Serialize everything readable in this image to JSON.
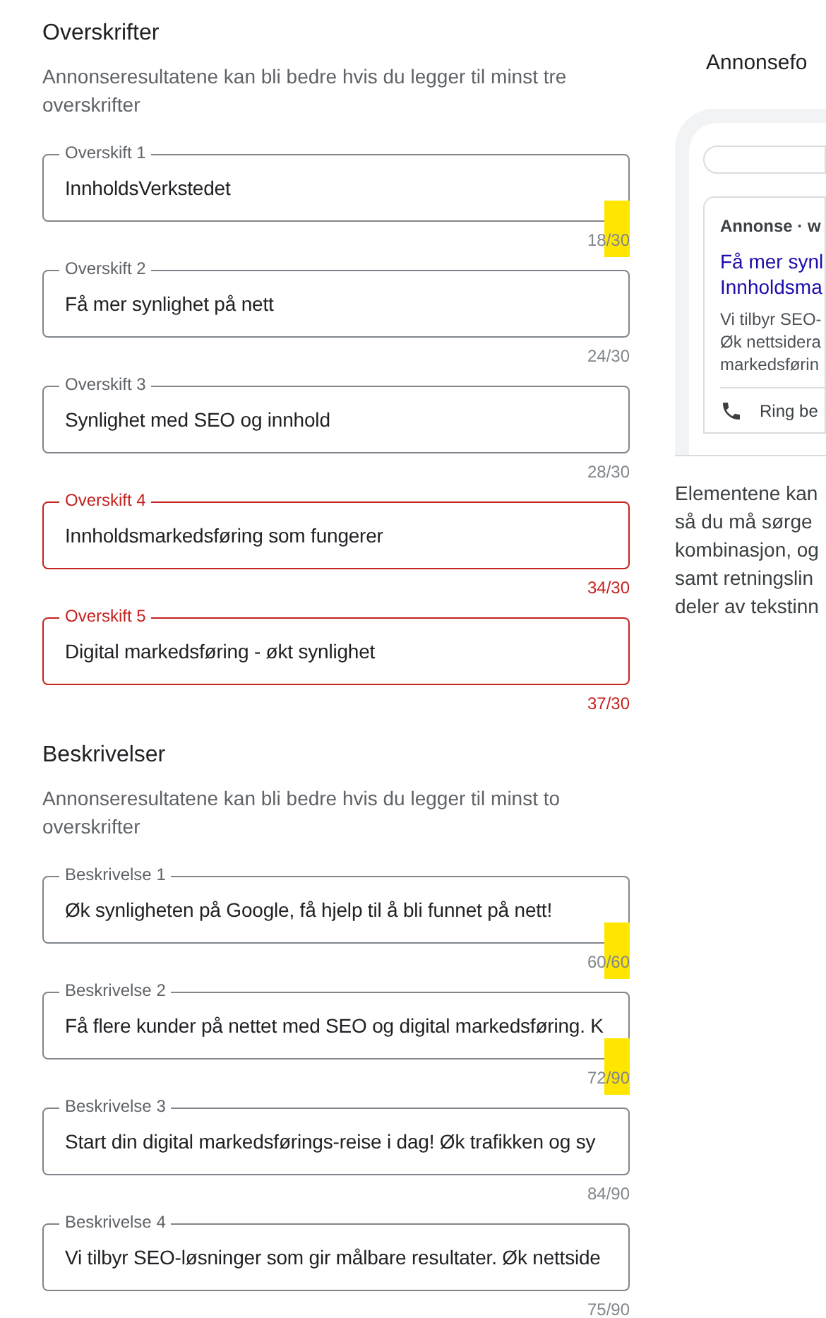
{
  "headlines": {
    "title": "Overskrifter",
    "hint": "Annonseresultatene kan bli bedre hvis du legger til minst tre overskrifter",
    "fields": [
      {
        "label": "Overskift 1",
        "value": "InnholdsVerkstedet",
        "counter": "18/30",
        "error": false,
        "highlighted": true
      },
      {
        "label": "Overskift 2",
        "value": "Få mer synlighet på nett",
        "counter": "24/30",
        "error": false,
        "highlighted": false
      },
      {
        "label": "Overskift 3",
        "value": "Synlighet med SEO og innhold",
        "counter": "28/30",
        "error": false,
        "highlighted": false
      },
      {
        "label": "Overskift 4",
        "value": "Innholdsmarkedsføring som fungerer",
        "counter": "34/30",
        "error": true,
        "highlighted": false
      },
      {
        "label": "Overskift 5",
        "value": "Digital markedsføring - økt synlighet",
        "counter": "37/30",
        "error": true,
        "highlighted": false
      }
    ]
  },
  "descriptions": {
    "title": "Beskrivelser",
    "hint": "Annonseresultatene kan bli bedre hvis du legger til minst to overskrifter",
    "fields": [
      {
        "label": "Beskrivelse 1",
        "value": "Øk synligheten på Google, få hjelp til å bli funnet på nett!",
        "counter": "60/60",
        "error": false,
        "highlighted": true
      },
      {
        "label": "Beskrivelse 2",
        "value": "Få flere kunder på nettet med SEO og digital markedsføring. K",
        "counter": "72/90",
        "error": false,
        "highlighted": true
      },
      {
        "label": "Beskrivelse 3",
        "value": "Start din digital markedsførings-reise i dag! Øk trafikken og sy",
        "counter": "84/90",
        "error": false,
        "highlighted": false
      },
      {
        "label": "Beskrivelse 4",
        "value": "Vi tilbyr SEO-løsninger som gir målbare resultater. Øk nettside",
        "counter": "75/90",
        "error": false,
        "highlighted": false
      }
    ]
  },
  "preview": {
    "title": "Annonsefo",
    "ad_label": "Annonse · w",
    "ad_title_lines": [
      "Få mer synl",
      "Innholdsma"
    ],
    "ad_text_lines": [
      "Vi tilbyr SEO-",
      "Øk nettsidera",
      "markedsførin"
    ],
    "call_label": "Ring be",
    "note_lines": [
      "Elementene kan",
      "så du må sørge",
      "kombinasjon, og",
      "samt retningslin",
      "deler av tekstinn"
    ]
  }
}
